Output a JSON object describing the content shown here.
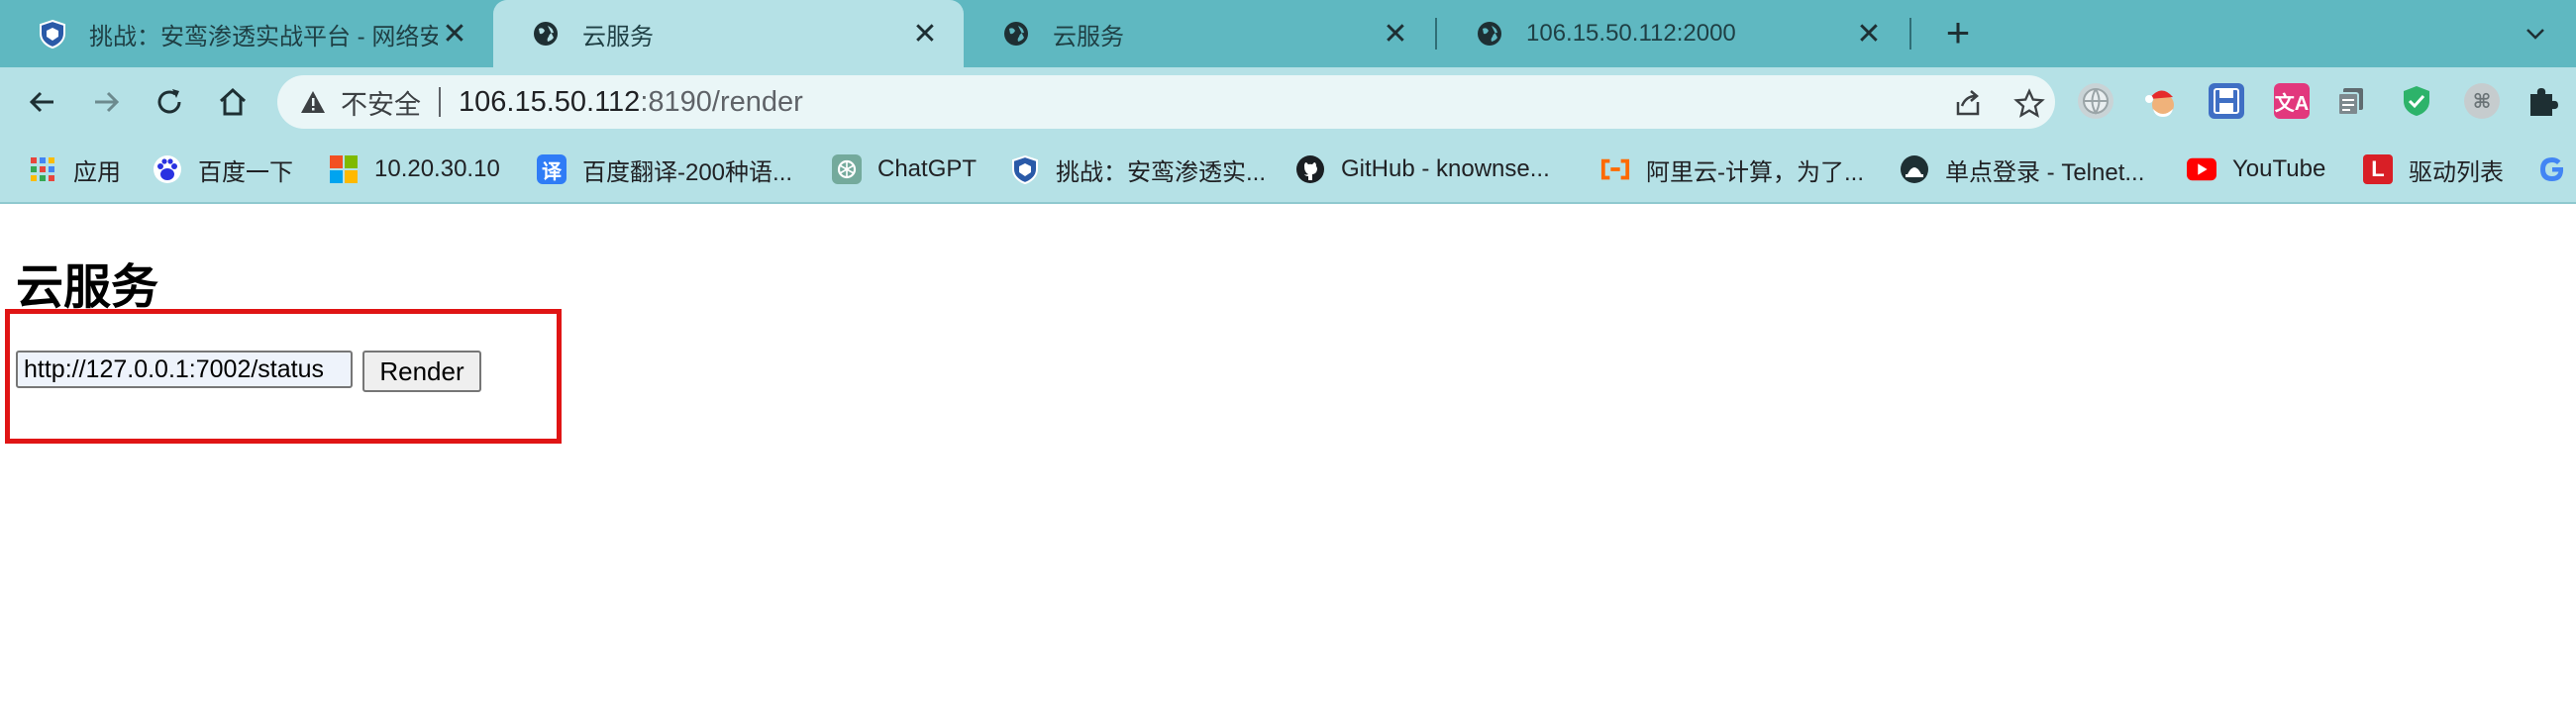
{
  "tabs": [
    {
      "title": "挑战：安鸾渗透实战平台 - 网络安",
      "icon": "shield-favicon",
      "active": false
    },
    {
      "title": "云服务",
      "icon": "globe-favicon",
      "active": true
    },
    {
      "title": "云服务",
      "icon": "globe-favicon",
      "active": false
    },
    {
      "title": "106.15.50.112:2000",
      "icon": "globe-favicon",
      "active": false
    }
  ],
  "omnibox": {
    "security_label": "不安全",
    "host": "106.15.50.112",
    "path": ":8190/render"
  },
  "bookmarks": [
    {
      "label": "应用",
      "icon": "apps-grid-icon"
    },
    {
      "label": "百度一下",
      "icon": "baidu-paw-icon"
    },
    {
      "label": "10.20.30.10",
      "icon": "windows-logo-icon"
    },
    {
      "label": "百度翻译-200种语...",
      "icon": "translate-icon",
      "icon_text": "译"
    },
    {
      "label": "ChatGPT",
      "icon": "chatgpt-icon"
    },
    {
      "label": "挑战：安鸾渗透实...",
      "icon": "shield-favicon"
    },
    {
      "label": "GitHub - knownse...",
      "icon": "github-icon"
    },
    {
      "label": "阿里云-计算，为了...",
      "icon": "aliyun-icon"
    },
    {
      "label": "单点登录 - Telnet...",
      "icon": "telnet-icon"
    },
    {
      "label": "YouTube",
      "icon": "youtube-icon"
    },
    {
      "label": "驱动列表",
      "icon": "driver-list-icon",
      "icon_text": "L"
    }
  ],
  "page": {
    "heading": "云服务",
    "url_value": "http://127.0.0.1:7002/status",
    "button_label": "Render"
  },
  "colors": {
    "tabstrip": "#5fb8c1",
    "toolbar": "#b5e1e6",
    "highlight_box": "#e01515"
  }
}
